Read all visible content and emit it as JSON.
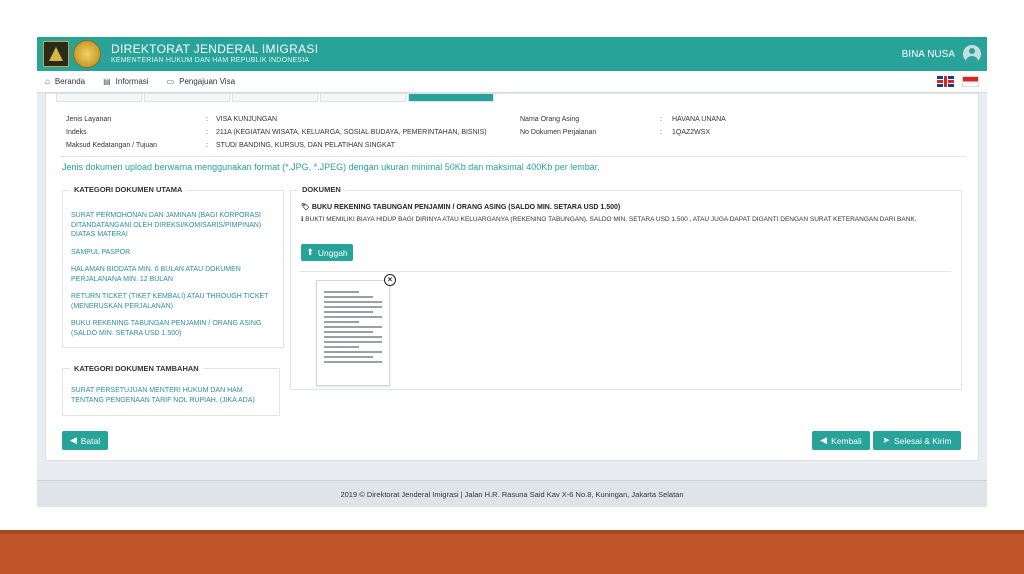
{
  "header": {
    "title": "DIREKTORAT JENDERAL IMIGRASI",
    "subtitle": "KEMENTERIAN HUKUM DAN HAM REPUBLIK INDONESIA",
    "user_name": "BINA NUSA"
  },
  "nav": {
    "items": [
      {
        "label": "Beranda",
        "icon": "home-icon"
      },
      {
        "label": "Informasi",
        "icon": "book-icon"
      },
      {
        "label": "Pengajuan Visa",
        "icon": "id-card-icon"
      }
    ]
  },
  "info": {
    "left": [
      {
        "key": "Jenis Layanan",
        "value": "VISA KUNJUNGAN"
      },
      {
        "key": "Indeks",
        "value": "211A   (KEGIATAN WISATA, KELUARGA, SOSIAL BUDAYA, PEMERINTAHAN, BISNIS)"
      },
      {
        "key": "Maksud Kedatangan / Tujuan",
        "value": "STUDI BANDING, KURSUS, DAN PELATIHAN SINGKAT"
      }
    ],
    "right": [
      {
        "key": "Nama Orang Asing",
        "value": "HAVANA UNANA"
      },
      {
        "key": "No Dokumen Perjalanan",
        "value": "1QAZ2WSX"
      }
    ]
  },
  "note": "Jenis dokumen upload berwarna menggunakan format (*.JPG, *.JPEG) dengan ukuran minimal 50Kb dan maksimal 400Kb per lembar.",
  "kategori_utama": {
    "title": "KATEGORI DOKUMEN UTAMA",
    "items": [
      "SURAT PERMOHONAN DAN JAMINAN (BAGI KORPORASI DITANDATANGANI OLEH DIREKSI/KOMISARIS/PIMPINAN) DIATAS MATERAI",
      "SAMPUL PASPOR",
      "HALAMAN BIODATA MIN. 6 BULAN ATAU DOKUMEN PERJALANANA MIN. 12 BULAN",
      "RETURN TICKET (TIKET KEMBALI) ATAU THROUGH TICKET (MENERUSKAN PERJALANAN)",
      "BUKU REKENING TABUNGAN PENJAMIN / ORANG ASING (SALDO MIN. SETARA USD 1.500)"
    ]
  },
  "kategori_tambahan": {
    "title": "KATEGORI DOKUMEN TAMBAHAN",
    "items": [
      "SURAT PERSETUJUAN MENTERI HUKUM DAN HAM TENTANG PENGENAAN TARIF NOL RUPIAH. (JIKA ADA)"
    ]
  },
  "dokumen": {
    "title": "DOKUMEN",
    "heading": "BUKU REKENING TABUNGAN PENJAMIN / ORANG ASING (SALDO MIN. SETARA USD 1.500)",
    "description": "BUKTI MEMILIKI BIAYA HIDUP BAGI DIRINYA ATAU KELUARGANYA (REKENING TABUNGAN), SALDO MIN. SETARA USD 1.500 , ATAU JUGA DAPAT DIGANTI DENGAN SURAT KETERANGAN DARI BANK.",
    "upload_label": "Unggah"
  },
  "buttons": {
    "batal": "Batal",
    "kembali": "Kembali",
    "selesai": "Selesai & Kirim"
  },
  "footer": "2019 © Direktorat Jenderal Imigrasi | Jalan H.R. Rasuna Said Kav X-6 No.8, Kuningan, Jakarta Selatan",
  "colors": {
    "accent": "#27a39a",
    "link": "#2a8fa0",
    "slide_band": "#bf5528"
  }
}
